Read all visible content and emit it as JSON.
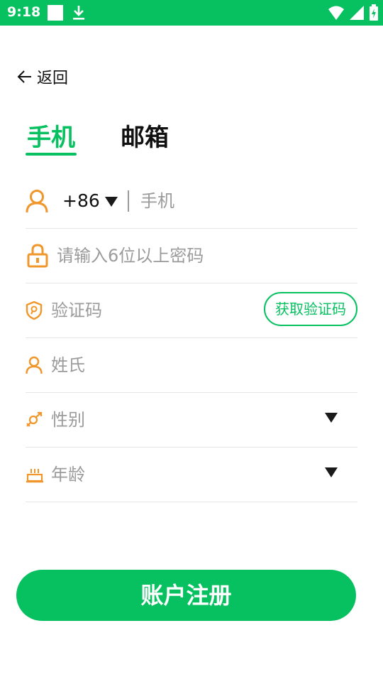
{
  "status_bar": {
    "time": "9:18"
  },
  "nav": {
    "back_label": "返回"
  },
  "tabs": [
    {
      "label": "手机",
      "active": true
    },
    {
      "label": "邮箱",
      "active": false
    }
  ],
  "form": {
    "country_code": "+86",
    "phone_placeholder": "手机",
    "password_placeholder": "请输入6位以上密码",
    "code_placeholder": "验证码",
    "get_code_label": "获取验证码",
    "surname_placeholder": "姓氏",
    "gender_placeholder": "性别",
    "age_placeholder": "年龄"
  },
  "submit_label": "账户注册",
  "colors": {
    "brand": "#07c160",
    "icon": "#f0962a",
    "placeholder": "#9b9b9b"
  }
}
